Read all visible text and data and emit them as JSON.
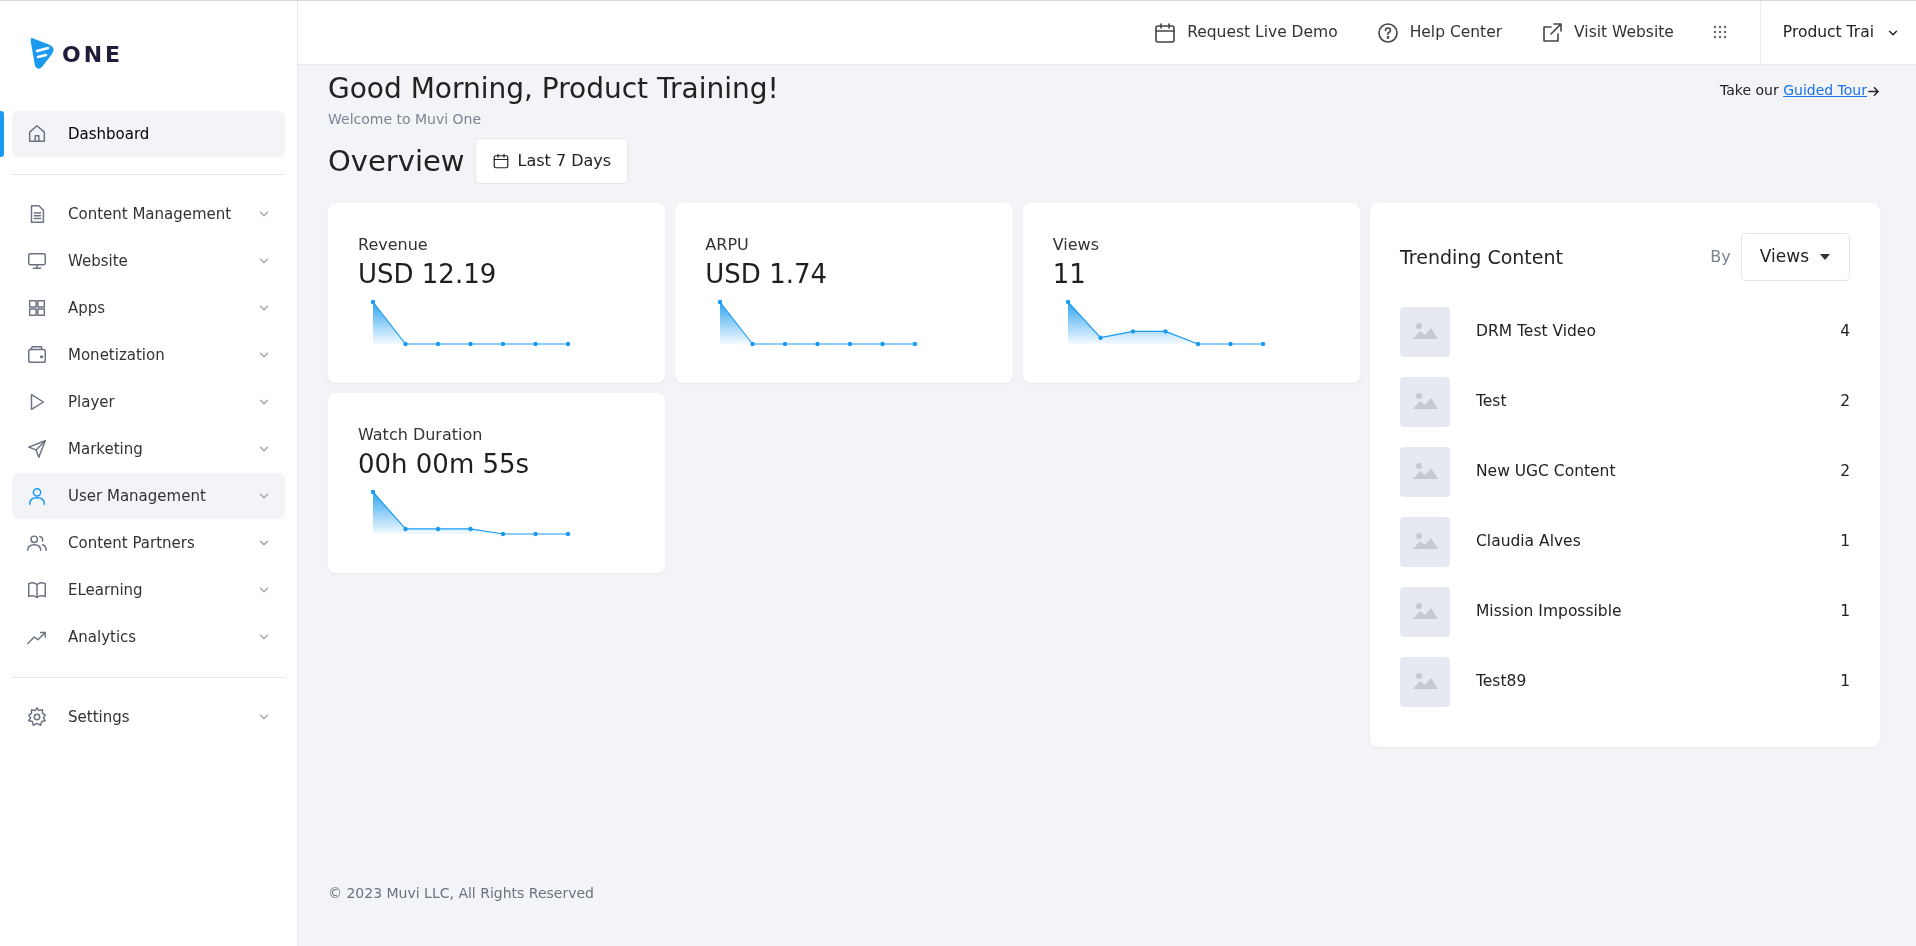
{
  "logo": {
    "text": "ONE"
  },
  "sidebar": {
    "groups": [
      {
        "items": [
          {
            "label": "Dashboard",
            "selected": true,
            "hovered": false,
            "has_submenu": false
          }
        ]
      },
      {
        "items": [
          {
            "label": "Content Management",
            "selected": false,
            "hovered": false,
            "has_submenu": true
          },
          {
            "label": "Website",
            "selected": false,
            "hovered": false,
            "has_submenu": true
          },
          {
            "label": "Apps",
            "selected": false,
            "hovered": false,
            "has_submenu": true
          },
          {
            "label": "Monetization",
            "selected": false,
            "hovered": false,
            "has_submenu": true
          },
          {
            "label": "Player",
            "selected": false,
            "hovered": false,
            "has_submenu": true
          },
          {
            "label": "Marketing",
            "selected": false,
            "hovered": false,
            "has_submenu": true
          },
          {
            "label": "User Management",
            "selected": false,
            "hovered": true,
            "has_submenu": true
          },
          {
            "label": "Content Partners",
            "selected": false,
            "hovered": false,
            "has_submenu": true
          },
          {
            "label": "ELearning",
            "selected": false,
            "hovered": false,
            "has_submenu": true
          },
          {
            "label": "Analytics",
            "selected": false,
            "hovered": false,
            "has_submenu": true
          }
        ]
      },
      {
        "items": [
          {
            "label": "Settings",
            "selected": false,
            "hovered": false,
            "has_submenu": true
          }
        ]
      }
    ]
  },
  "header": {
    "links": [
      {
        "label": "Request Live Demo"
      },
      {
        "label": "Help Center"
      },
      {
        "label": "Visit Website"
      }
    ],
    "user": {
      "name": "Product Trai"
    }
  },
  "greeting": {
    "title": "Good Morning, Product Training!",
    "subtitle": "Welcome to Muvi One",
    "tour_prefix": "Take our",
    "tour_link": "Guided Tour"
  },
  "overview": {
    "title": "Overview",
    "range": "Last 7 Days"
  },
  "metrics": [
    {
      "label": "Revenue",
      "value": "USD 12.19"
    },
    {
      "label": "ARPU",
      "value": "USD 1.74"
    },
    {
      "label": "Views",
      "value": "11"
    },
    {
      "label": "Watch Duration",
      "value": "00h 00m 55s"
    }
  ],
  "trending": {
    "title": "Trending Content",
    "by_label": "By",
    "sort": "Views",
    "items": [
      {
        "title": "DRM Test Video",
        "count": "4"
      },
      {
        "title": "Test",
        "count": "2"
      },
      {
        "title": "New UGC Content",
        "count": "2"
      },
      {
        "title": "Claudia Alves",
        "count": "1"
      },
      {
        "title": "Mission Impossible",
        "count": "1"
      },
      {
        "title": "Test89",
        "count": "1"
      }
    ]
  },
  "footer": {
    "text": "© 2023 Muvi LLC, All Rights Reserved"
  }
}
